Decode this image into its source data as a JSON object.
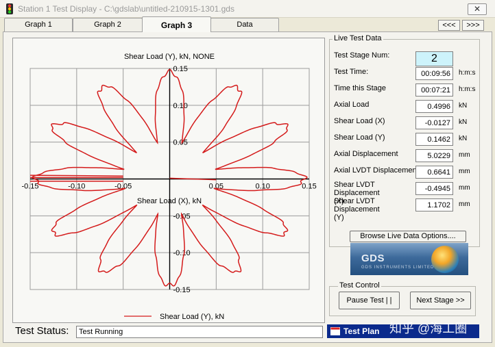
{
  "window": {
    "title": "Station 1 Test Display - C:\\gdslab\\untitled-210915-1301.gds",
    "close_label": "✕"
  },
  "tabs": [
    {
      "label": "Graph 1"
    },
    {
      "label": "Graph 2"
    },
    {
      "label": "Graph 3"
    },
    {
      "label": "Data"
    }
  ],
  "nav": {
    "prev": "<<<",
    "next": ">>>"
  },
  "chart_data": {
    "type": "line",
    "title": "Shear Load (Y), kN, NONE",
    "xlabel": "Shear Load (X), kN",
    "ylabel": "",
    "legend": "Shear Load (Y), kN",
    "legend_position": "bottom",
    "xlim": [
      -0.15,
      0.15
    ],
    "ylim": [
      -0.15,
      0.15
    ],
    "xticks": [
      -0.15,
      -0.1,
      -0.05,
      0.05,
      0.1,
      0.15
    ],
    "xtick_labels": [
      "-0.15",
      "-0.10",
      "-0.05",
      "0.05",
      "0.10",
      "0.15"
    ],
    "yticks": [
      0.15,
      0.1,
      0.05,
      -0.05,
      -0.1,
      -0.15
    ],
    "ytick_labels": [
      "0.15",
      "0.10",
      "0.05",
      "-0.05",
      "-0.10",
      "-0.15"
    ],
    "grid": true,
    "series": [
      {
        "name": "Shear Load (Y), kN",
        "color": "#d41a1a",
        "shape": "rose",
        "petals": 12,
        "inner_radius": 0.05,
        "outer_radius": 0.145,
        "center": [
          0,
          0
        ]
      }
    ]
  },
  "live_data": {
    "group_label": "Live Test Data",
    "rows": [
      {
        "label": "Test Stage Num:",
        "value": "2",
        "unit": ""
      },
      {
        "label": "Test Time:",
        "value": "00:09:56",
        "unit": "h:m:s"
      },
      {
        "label": "Time this Stage",
        "value": "00:07:21",
        "unit": "h:m:s"
      },
      {
        "label": "Axial Load",
        "value": "0.4996",
        "unit": "kN"
      },
      {
        "label": "Shear Load (X)",
        "value": "-0.0127",
        "unit": "kN"
      },
      {
        "label": "Shear Load (Y)",
        "value": "0.1462",
        "unit": "kN"
      },
      {
        "label": "Axial Displacement",
        "value": "5.0229",
        "unit": "mm"
      },
      {
        "label": "Axial LVDT Displacement",
        "value": "0.6641",
        "unit": "mm"
      },
      {
        "label": "Shear LVDT Displacement (X)",
        "value": "-0.4945",
        "unit": "mm"
      },
      {
        "label": "Shear LVDT Displacement (Y)",
        "value": "1.1702",
        "unit": "mm"
      }
    ],
    "browse_label": "Browse Live Data Options...."
  },
  "logo": {
    "text": "GDS",
    "subtext": "GDS INSTRUMENTS LIMITED"
  },
  "test_control": {
    "group_label": "Test Control",
    "pause_label": "Pause Test | |",
    "next_label": "Next Stage >>"
  },
  "status": {
    "label": "Test Status:",
    "value": "Test Running"
  },
  "test_plan_label": "Test Plan",
  "watermark": "知乎 @海工圈",
  "colors": {
    "accent": "#0b2a8c",
    "stage_bg": "#cdf3fb",
    "plot_line": "#d41a1a"
  }
}
